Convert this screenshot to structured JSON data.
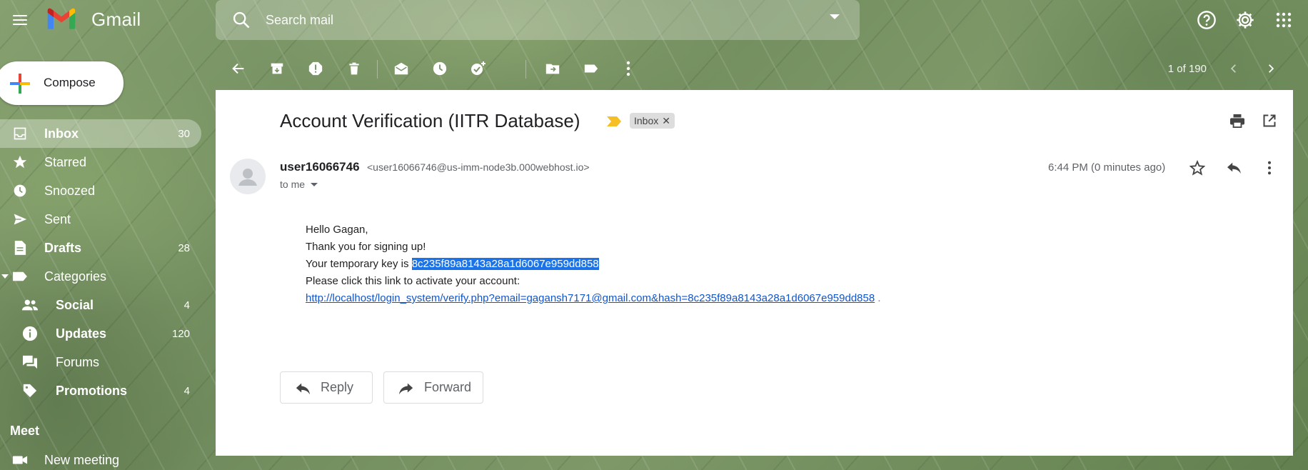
{
  "app": {
    "brand": "Gmail"
  },
  "search": {
    "placeholder": "Search mail"
  },
  "compose": {
    "label": "Compose"
  },
  "nav": [
    {
      "id": "inbox",
      "label": "Inbox",
      "count": "30",
      "bold": true,
      "active": true,
      "icon": "inbox-icon"
    },
    {
      "id": "starred",
      "label": "Starred",
      "count": "",
      "bold": false,
      "icon": "star-icon"
    },
    {
      "id": "snoozed",
      "label": "Snoozed",
      "count": "",
      "bold": false,
      "icon": "clock-icon"
    },
    {
      "id": "sent",
      "label": "Sent",
      "count": "",
      "bold": false,
      "icon": "send-icon"
    },
    {
      "id": "drafts",
      "label": "Drafts",
      "count": "28",
      "bold": true,
      "icon": "draft-icon"
    },
    {
      "id": "categories",
      "label": "Categories",
      "count": "",
      "bold": false,
      "icon": "label-icon"
    },
    {
      "id": "social",
      "label": "Social",
      "count": "4",
      "bold": true,
      "sub": true,
      "icon": "people-icon"
    },
    {
      "id": "updates",
      "label": "Updates",
      "count": "120",
      "bold": true,
      "sub": true,
      "icon": "info-icon"
    },
    {
      "id": "forums",
      "label": "Forums",
      "count": "",
      "bold": false,
      "sub": true,
      "icon": "forum-icon"
    },
    {
      "id": "promotions",
      "label": "Promotions",
      "count": "4",
      "bold": true,
      "sub": true,
      "icon": "tag-icon"
    }
  ],
  "meet": {
    "title": "Meet",
    "new_meeting": "New meeting"
  },
  "pager": {
    "text": "1 of 190"
  },
  "message": {
    "subject": "Account Verification (IITR Database)",
    "label": "Inbox",
    "sender_name": "user16066746",
    "sender_email": "<user16066746@us-imm-node3b.000webhost.io>",
    "to": "to me",
    "time": "6:44 PM (0 minutes ago)",
    "body": {
      "greeting": "Hello Gagan,",
      "line1": "Thank you for signing up!",
      "line2_prefix": "Your temporary key is ",
      "key": "8c235f89a8143a28a1d6067e959dd858",
      "line3": "Please click this link to activate your account:",
      "link": "http://localhost/login_system/verify.php?email=gagansh7171@gmail.com&hash=8c235f89a8143a28a1d6067e959dd858",
      "link_suffix": " ."
    }
  },
  "actions": {
    "reply": "Reply",
    "forward": "Forward"
  },
  "colors": {
    "highlight": "#1a73e8",
    "link": "#1155cc",
    "important": "#f6bf26"
  }
}
